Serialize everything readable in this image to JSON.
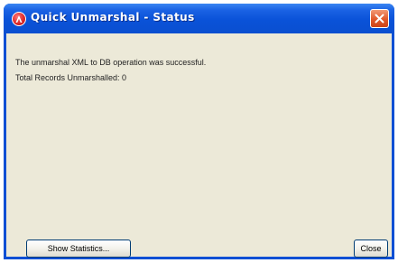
{
  "window": {
    "title": "Quick Unmarshal - Status",
    "title_color": "#ffffff",
    "titlebar_color": "#0a52d8",
    "close_button_color": "#e0582a"
  },
  "message": {
    "line1": "The unmarshal XML to DB operation was successful.",
    "line2": "Total Records Unmarshalled:  0"
  },
  "buttons": {
    "show_statistics": "Show Statistics...",
    "close": "Close"
  },
  "icons": {
    "app": "app-logo-icon",
    "close": "close-icon"
  }
}
